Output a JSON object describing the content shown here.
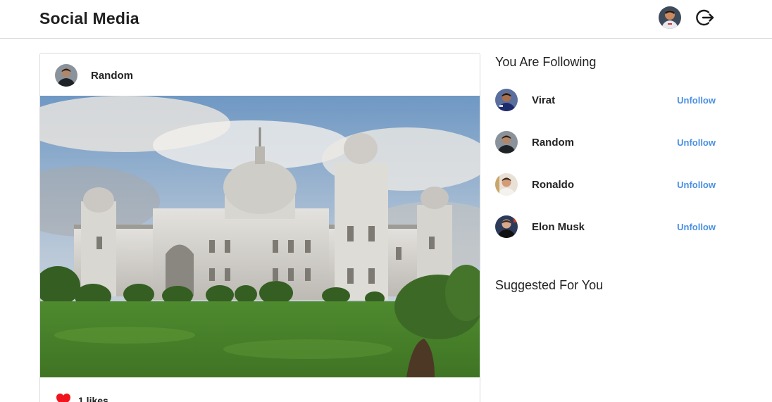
{
  "navbar": {
    "brand": "Social Media",
    "avatar_icon": "user-avatar",
    "logout_icon": "logout-icon"
  },
  "post": {
    "author": "Random",
    "image_alt": "photo",
    "likes_label": "1 likes",
    "like_color": "#f0141e"
  },
  "sidebar": {
    "following_title": "You Are Following",
    "following": [
      {
        "name": "Virat",
        "action": "Unfollow"
      },
      {
        "name": "Random",
        "action": "Unfollow"
      },
      {
        "name": "Ronaldo",
        "action": "Unfollow"
      },
      {
        "name": "Elon Musk",
        "action": "Unfollow"
      }
    ],
    "suggested_title": "Suggested For You"
  },
  "colors": {
    "accent": "#4a90e2",
    "border": "#dcdcdc"
  }
}
